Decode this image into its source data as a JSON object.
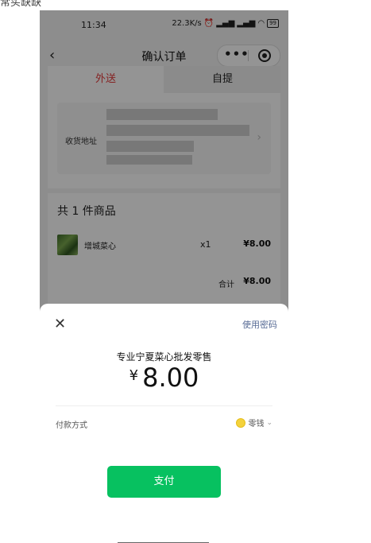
{
  "top_fragment": "常买缺缺",
  "status_bar": {
    "time": "11:34",
    "net_speed": "22.3K/s",
    "battery": "99"
  },
  "nav": {
    "title": "确认订单",
    "more_glyph": "•••"
  },
  "tabs": {
    "delivery": "外送",
    "pickup": "自提",
    "active_color": "#e53b3b"
  },
  "address": {
    "label": "收货地址"
  },
  "items": {
    "title": "共 1 件商品",
    "products": [
      {
        "name": "增城菜心",
        "qty": "x1",
        "price": "¥8.00"
      }
    ],
    "total_label": "合计",
    "total_value": "¥8.00"
  },
  "payment": {
    "close_glyph": "✕",
    "use_password": "使用密码",
    "merchant": "专业宁夏菜心批发零售",
    "currency": "¥",
    "amount": "8.00",
    "method_label": "付款方式",
    "method_value": "零钱",
    "pay_button": "支付",
    "button_color": "#07c160",
    "link_color": "#576b95"
  }
}
